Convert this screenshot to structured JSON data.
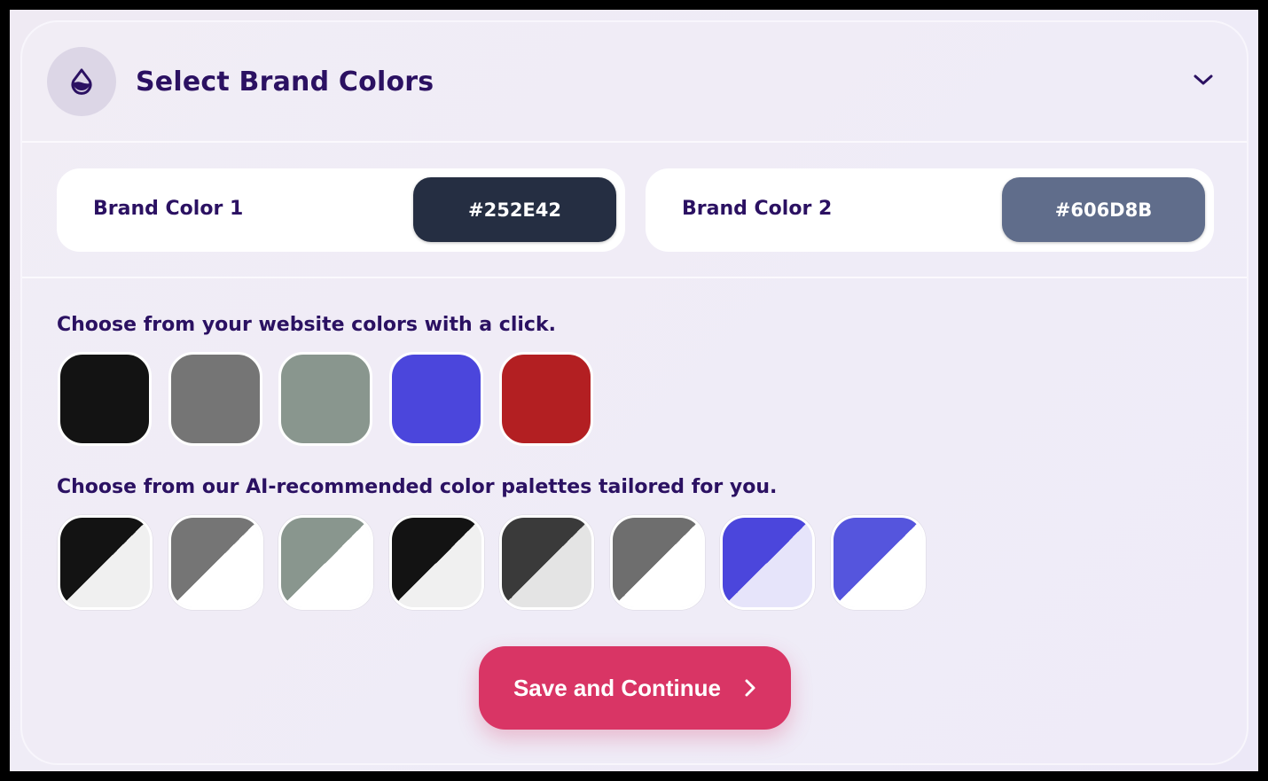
{
  "header": {
    "title": "Select Brand Colors",
    "icon": "water-drop-icon",
    "toggle_icon": "chevron-down-icon"
  },
  "brand_colors": [
    {
      "label": "Brand Color 1",
      "value": "#252E42",
      "color": "#252E42"
    },
    {
      "label": "Brand Color 2",
      "value": "#606D8B",
      "color": "#606D8B"
    }
  ],
  "website_colors": {
    "label": "Choose from your website colors with a click.",
    "swatches": [
      "#131313",
      "#757575",
      "#89968E",
      "#4B46DC",
      "#B31F22"
    ]
  },
  "ai_palettes": {
    "label": "Choose from our AI-recommended color palettes tailored for you.",
    "palettes": [
      {
        "primary": "#131313",
        "secondary": "#F0F0F0"
      },
      {
        "primary": "#757575",
        "secondary": "#FFFFFF"
      },
      {
        "primary": "#89968E",
        "secondary": "#FFFFFF"
      },
      {
        "primary": "#131313",
        "secondary": "#F0F0F0"
      },
      {
        "primary": "#3A3A3A",
        "secondary": "#E4E4E4"
      },
      {
        "primary": "#6E6E6E",
        "secondary": "#FFFFFF"
      },
      {
        "primary": "#4B46DC",
        "secondary": "#E6E4FA"
      },
      {
        "primary": "#5555DD",
        "secondary": "#FFFFFF"
      }
    ]
  },
  "actions": {
    "save_label": "Save and Continue",
    "save_icon": "chevron-right-icon",
    "accent": "#D93565"
  }
}
